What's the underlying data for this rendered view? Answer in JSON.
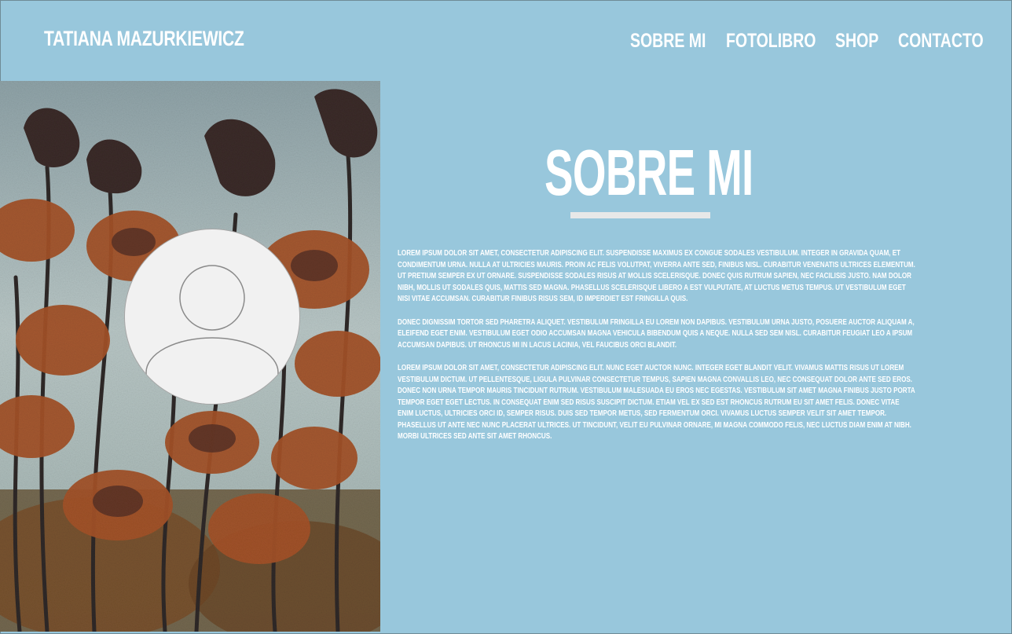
{
  "header": {
    "brand": "TATIANA MAZURKIEWICZ",
    "nav": [
      {
        "label": "SOBRE MI"
      },
      {
        "label": "FOTOLIBRO"
      },
      {
        "label": "SHOP"
      },
      {
        "label": "CONTACTO"
      }
    ]
  },
  "hero": {
    "image_description_icon": "flower-photo",
    "avatar_icon": "user-placeholder-icon"
  },
  "about": {
    "title": "SOBRE MI",
    "paragraphs": [
      "Lorem ipsum dolor sit amet, consectetur adipiscing elit. Suspendisse maximus ex congue sodales vestibulum. Integer in gravida quam, et condimentum urna. Nulla at ultricies mauris. Proin ac felis volutpat, viverra ante sed, finibus nisl. Curabitur venenatis ultrices elementum. Ut pretium semper ex ut ornare. Suspendisse sodales risus at mollis scelerisque. Donec quis rutrum sapien, nec facilisis justo. Nam dolor nibh, mollis ut sodales quis, mattis sed magna. Phasellus scelerisque libero a est vulputate, at luctus metus tempus. Ut vestibulum eget nisi vitae accumsan. Curabitur finibus risus sem, id imperdiet est fringilla quis.",
      "Donec dignissim tortor sed pharetra aliquet. Vestibulum fringilla eu lorem non dapibus. Vestibulum urna justo, posuere auctor aliquam a, eleifend eget enim. Vestibulum eget odio accumsan magna vehicula bibendum quis a neque. Nulla sed sem nisl. Curabitur feugiat leo a ipsum accumsan dapibus. Ut rhoncus mi in lacus lacinia, vel faucibus orci blandit.",
      "Lorem ipsum dolor sit amet, consectetur adipiscing elit. Nunc eget auctor nunc. Integer eget blandit velit. Vivamus mattis risus ut lorem vestibulum dictum. Ut pellentesque, ligula pulvinar consectetur tempus, sapien magna convallis leo, nec consequat dolor ante sed eros. Donec non urna tempor mauris tincidunt rutrum. Vestibulum malesuada eu eros nec egestas. Vestibulum sit amet magna finibus justo porta tempor eget eget lectus. In consequat enim sed risus suscipit dictum. Etiam vel ex sed est rhoncus rutrum eu sit amet felis. Donec vitae enim luctus, ultricies orci id, semper risus. Duis sed tempor metus, sed fermentum orci. Vivamus luctus semper velit sit amet tempor. Phasellus ut ante nec nunc placerat ultrices. Ut tincidunt, velit eu pulvinar ornare, mi magna commodo felis, nec luctus diam enim at nibh. Morbi ultrices sed ante sit amet rhoncus."
    ]
  },
  "colors": {
    "background": "#98c7dc",
    "text": "#ffffff",
    "underline": "#e8e8e8",
    "avatar_bg": "#f1f1f1"
  }
}
